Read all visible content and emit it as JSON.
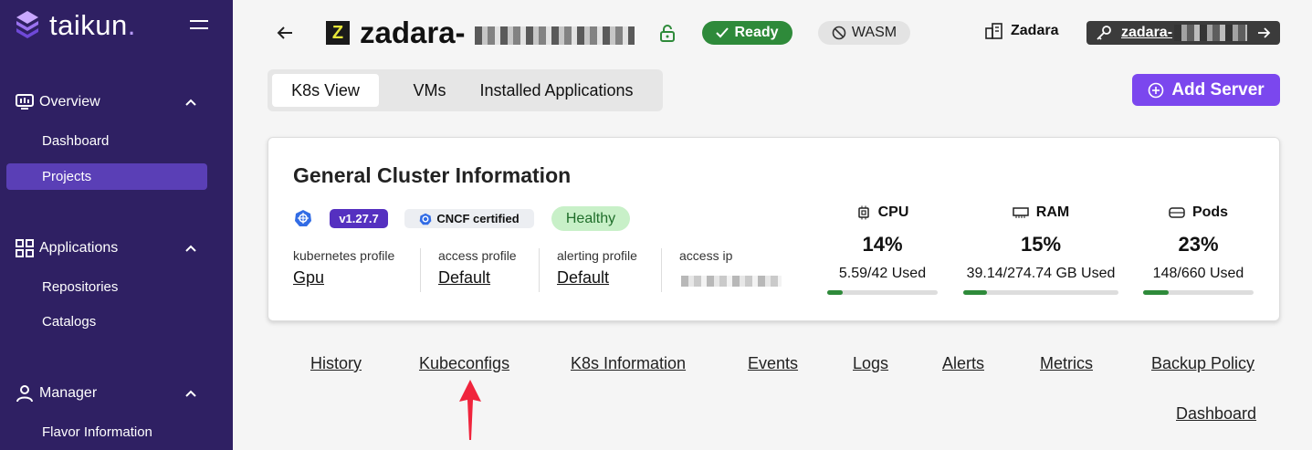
{
  "brand": {
    "name": "taikun",
    "dot": "."
  },
  "sidebar": {
    "sections": [
      {
        "label": "Overview",
        "items": [
          "Dashboard",
          "Projects"
        ]
      },
      {
        "label": "Applications",
        "items": [
          "Repositories",
          "Catalogs"
        ]
      },
      {
        "label": "Manager",
        "items": [
          "Flavor Information"
        ]
      }
    ],
    "active_item": "Projects"
  },
  "header": {
    "project_logo_letter": "Z",
    "project_title": "zadara-",
    "status": "Ready",
    "wasm": "WASM",
    "organization": "Zadara",
    "user": "zadara-"
  },
  "tabs": [
    "K8s View",
    "VMs",
    "Installed Applications"
  ],
  "add_server": "Add Server",
  "card": {
    "title": "General Cluster Information",
    "version": "v1.27.7",
    "cncf": "CNCF certified",
    "health": "Healthy",
    "profiles": [
      {
        "label": "kubernetes profile",
        "value": "Gpu"
      },
      {
        "label": "access profile",
        "value": "Default"
      },
      {
        "label": "alerting profile",
        "value": "Default"
      },
      {
        "label": "access ip",
        "value": ""
      }
    ],
    "metrics": [
      {
        "name": "CPU",
        "percent": "14%",
        "used": "5.59/42 Used",
        "fill": 0.14,
        "icon": "cpu-icon"
      },
      {
        "name": "RAM",
        "percent": "15%",
        "used": "39.14/274.74 GB Used",
        "fill": 0.15,
        "icon": "ram-icon"
      },
      {
        "name": "Pods",
        "percent": "23%",
        "used": "148/660 Used",
        "fill": 0.23,
        "icon": "pods-icon"
      }
    ]
  },
  "links": [
    "History",
    "Kubeconfigs",
    "K8s Information",
    "Events",
    "Logs",
    "Alerts",
    "Metrics",
    "Backup Policy",
    "Dashboard"
  ],
  "colors": {
    "sidebar": "#2f2063",
    "accent": "#7b47ee",
    "ready": "#2e8a3a",
    "annotation": "#f0243c"
  }
}
